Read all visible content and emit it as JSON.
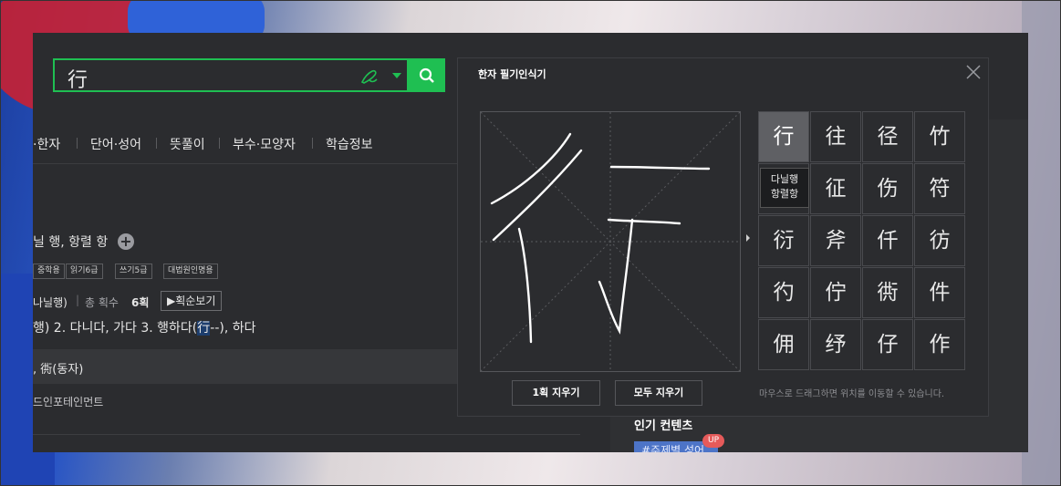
{
  "search": {
    "query": "行"
  },
  "tabs": [
    "·한자",
    "단어·성어",
    "뜻풀이",
    "부수·모양자",
    "학습정보"
  ],
  "entry": {
    "meaning": "닐 행, 항렬 항",
    "badges": [
      "중학용",
      "읽기6급",
      "쓰기5급",
      "대법원인명용"
    ],
    "radical": "나닐행)",
    "stroke_label": "총 획수",
    "stroke_count": "6획",
    "stroke_button": "▶획순보기",
    "def_pre": "행)  2. 다니다, 가다  3. 행하다(",
    "def_char": "行",
    "def_post": "--), 하다",
    "row2": ", 衖(동자)",
    "row3": "드인포테인먼트"
  },
  "sidebar": {
    "popular_title": "인기 컨텐츠",
    "tag": "#주제별 성어",
    "up_badge": "UP"
  },
  "handwriting": {
    "title": "한자 필기인식기",
    "candidates": [
      "行",
      "往",
      "径",
      "竹",
      "",
      "征",
      "伤",
      "符",
      "衍",
      "斧",
      "仟",
      "彷",
      "彴",
      "佇",
      "衖",
      "件",
      "佣",
      "纾",
      "仔",
      "作"
    ],
    "tooltip_line1": "다닐행",
    "tooltip_line2": "항렬항",
    "erase_one": "1획 지우기",
    "erase_all": "모두 지우기",
    "hint": "마우스로 드래그하면 위치를 이동할 수 있습니다."
  }
}
